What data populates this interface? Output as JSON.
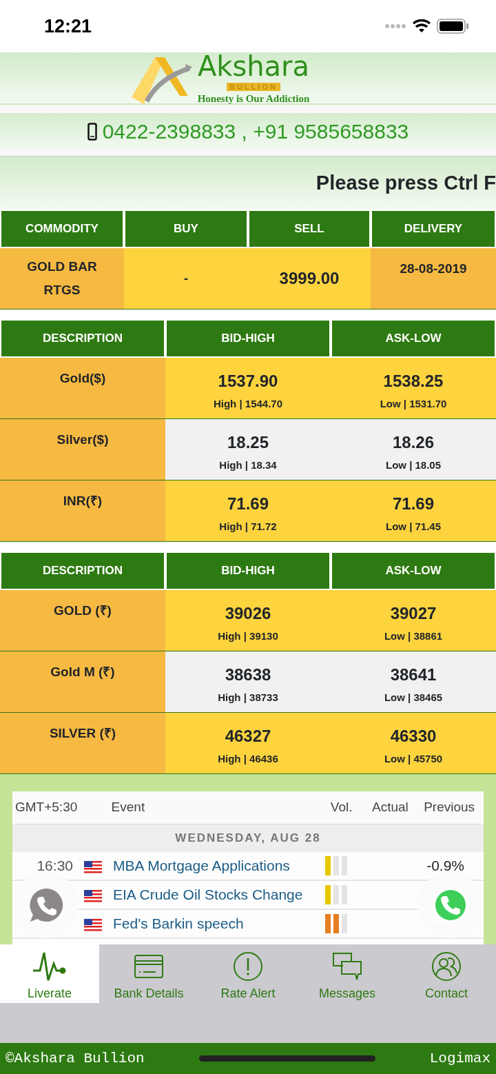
{
  "status_bar": {
    "time": "12:21"
  },
  "header": {
    "brand": "Akshara",
    "sub": "BULLION",
    "tagline": "Honesty is Our Addiction"
  },
  "phone": {
    "text": "0422-2398833 , +91 9585658833"
  },
  "marquee": {
    "text": "Please press Ctrl F"
  },
  "commodity_table": {
    "columns": [
      "COMMODITY",
      "BUY",
      "SELL",
      "DELIVERY"
    ],
    "rows": [
      {
        "name": "GOLD BAR RTGS",
        "buy": "-",
        "sell": "3999.00",
        "delivery": "28-08-2019"
      }
    ]
  },
  "rate_tables": [
    {
      "columns": [
        "DESCRIPTION",
        "BID-HIGH",
        "ASK-LOW"
      ],
      "rows": [
        {
          "description": "Gold($)",
          "bid": "1537.90",
          "high": "High | 1544.70",
          "ask": "1538.25",
          "low": "Low | 1531.70"
        },
        {
          "description": "Silver($)",
          "bid": "18.25",
          "high": "High | 18.34",
          "ask": "18.26",
          "low": "Low | 18.05"
        },
        {
          "description": "INR(₹)",
          "bid": "71.69",
          "high": "High | 71.72",
          "ask": "71.69",
          "low": "Low | 71.45"
        }
      ]
    },
    {
      "columns": [
        "DESCRIPTION",
        "BID-HIGH",
        "ASK-LOW"
      ],
      "rows": [
        {
          "description": "GOLD (₹)",
          "bid": "39026",
          "high": "High | 39130",
          "ask": "39027",
          "low": "Low | 38861"
        },
        {
          "description": "Gold M (₹)",
          "bid": "38638",
          "high": "High | 38733",
          "ask": "38641",
          "low": "Low | 38465"
        },
        {
          "description": "SILVER (₹)",
          "bid": "46327",
          "high": "High | 46436",
          "ask": "46330",
          "low": "Low | 45750"
        }
      ]
    }
  ],
  "calendar": {
    "columns": [
      "GMT+5:30",
      "Event",
      "Vol.",
      "Actual",
      "Previous"
    ],
    "day": "WEDNESDAY, AUG 28",
    "events": [
      {
        "time": "16:30",
        "event": "MBA Mortgage Applications",
        "volatility": {
          "level": 0.333
        },
        "previous": "-0.9%"
      },
      {
        "event": "EIA Crude Oil Stocks Change",
        "volatility": {
          "level": 0.333
        }
      },
      {
        "event": "Fed's Barkin speech",
        "volatility": {
          "level": 0.667
        }
      }
    ]
  },
  "tabs": [
    {
      "label": "Liverate",
      "selected": true
    },
    {
      "label": "Bank Details",
      "selected": false
    },
    {
      "label": "Rate Alert",
      "selected": false
    },
    {
      "label": "Messages",
      "selected": false
    },
    {
      "label": "Contact",
      "selected": false
    }
  ],
  "footer": {
    "left": "©Akshara Bullion",
    "right": "Logimax"
  }
}
